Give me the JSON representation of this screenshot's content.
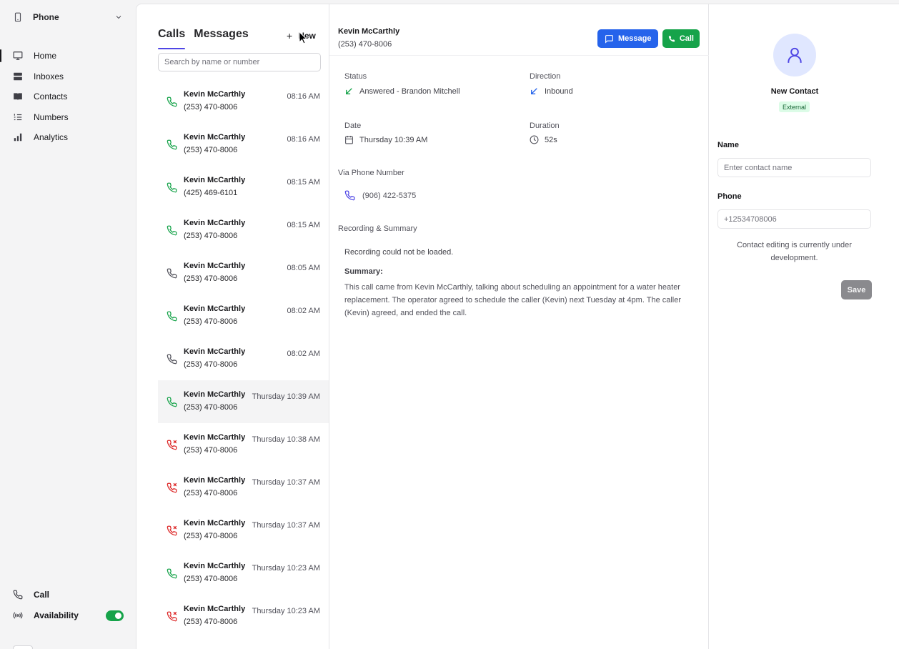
{
  "sidebar": {
    "app_label": "Phone",
    "app_icon": "smartphone-icon",
    "nav": [
      {
        "label": "Home",
        "icon": "monitor-icon",
        "active": true
      },
      {
        "label": "Inboxes",
        "icon": "inbox-icon"
      },
      {
        "label": "Contacts",
        "icon": "book-icon"
      },
      {
        "label": "Numbers",
        "icon": "list-numbered-icon"
      },
      {
        "label": "Analytics",
        "icon": "bar-chart-icon"
      }
    ],
    "bottom": [
      {
        "label": "Call",
        "icon": "phone-icon"
      },
      {
        "label": "Availability",
        "icon": "broadcast-icon",
        "toggle_on": true
      }
    ]
  },
  "calls_panel": {
    "tabs": [
      "Calls",
      "Messages"
    ],
    "active_tab": "Calls",
    "new_label": "New",
    "search_placeholder": "Search by name or number",
    "calls": [
      {
        "name": "Kevin McCarthly",
        "number": "(253) 470-8006",
        "time": "08:16 AM",
        "status": "answered"
      },
      {
        "name": "Kevin McCarthly",
        "number": "(253) 470-8006",
        "time": "08:16 AM",
        "status": "answered"
      },
      {
        "name": "Kevin McCarthly",
        "number": "(425) 469-6101",
        "time": "08:15 AM",
        "status": "answered"
      },
      {
        "name": "Kevin McCarthly",
        "number": "(253) 470-8006",
        "time": "08:15 AM",
        "status": "answered"
      },
      {
        "name": "Kevin McCarthly",
        "number": "(253) 470-8006",
        "time": "08:05 AM",
        "status": "neutral"
      },
      {
        "name": "Kevin McCarthly",
        "number": "(253) 470-8006",
        "time": "08:02 AM",
        "status": "answered"
      },
      {
        "name": "Kevin McCarthly",
        "number": "(253) 470-8006",
        "time": "08:02 AM",
        "status": "neutral"
      },
      {
        "name": "Kevin McCarthly",
        "number": "(253) 470-8006",
        "time": "Thursday 10:39 AM",
        "status": "answered",
        "selected": true
      },
      {
        "name": "Kevin McCarthly",
        "number": "(253) 470-8006",
        "time": "Thursday 10:38 AM",
        "status": "missed"
      },
      {
        "name": "Kevin McCarthly",
        "number": "(253) 470-8006",
        "time": "Thursday 10:37 AM",
        "status": "missed"
      },
      {
        "name": "Kevin McCarthly",
        "number": "(253) 470-8006",
        "time": "Thursday 10:37 AM",
        "status": "missed"
      },
      {
        "name": "Kevin McCarthly",
        "number": "(253) 470-8006",
        "time": "Thursday 10:23 AM",
        "status": "answered"
      },
      {
        "name": "Kevin McCarthly",
        "number": "(253) 470-8006",
        "time": "Thursday 10:23 AM",
        "status": "missed"
      }
    ]
  },
  "detail": {
    "name": "Kevin McCarthly",
    "number": "(253) 470-8006",
    "message_label": "Message",
    "call_label": "Call",
    "status_label": "Status",
    "status_value": "Answered - Brandon Mitchell",
    "direction_label": "Direction",
    "direction_value": "Inbound",
    "date_label": "Date",
    "date_value": "Thursday 10:39 AM",
    "duration_label": "Duration",
    "duration_value": "52s",
    "via_label": "Via Phone Number",
    "via_value": "(906) 422-5375",
    "recording_label": "Recording & Summary",
    "recording_msg": "Recording could not be loaded.",
    "summary_label": "Summary:",
    "summary_text": "This call came from Kevin McCarthly, talking about scheduling an appointment for a water heater replacement. The operator agreed to schedule the caller (Kevin) next Tuesday at 4pm. The caller (Kevin) agreed, and ended the call."
  },
  "contact": {
    "title": "New Contact",
    "badge": "External",
    "name_label": "Name",
    "name_placeholder": "Enter contact name",
    "phone_label": "Phone",
    "phone_placeholder": "+12534708006",
    "dev_note": "Contact editing is currently under development.",
    "save_label": "Save"
  },
  "colors": {
    "accent": "#4f46e5",
    "message_button": "#2563eb",
    "call_button": "#16a34a",
    "answered": "#16a34a",
    "missed": "#dc2626"
  }
}
